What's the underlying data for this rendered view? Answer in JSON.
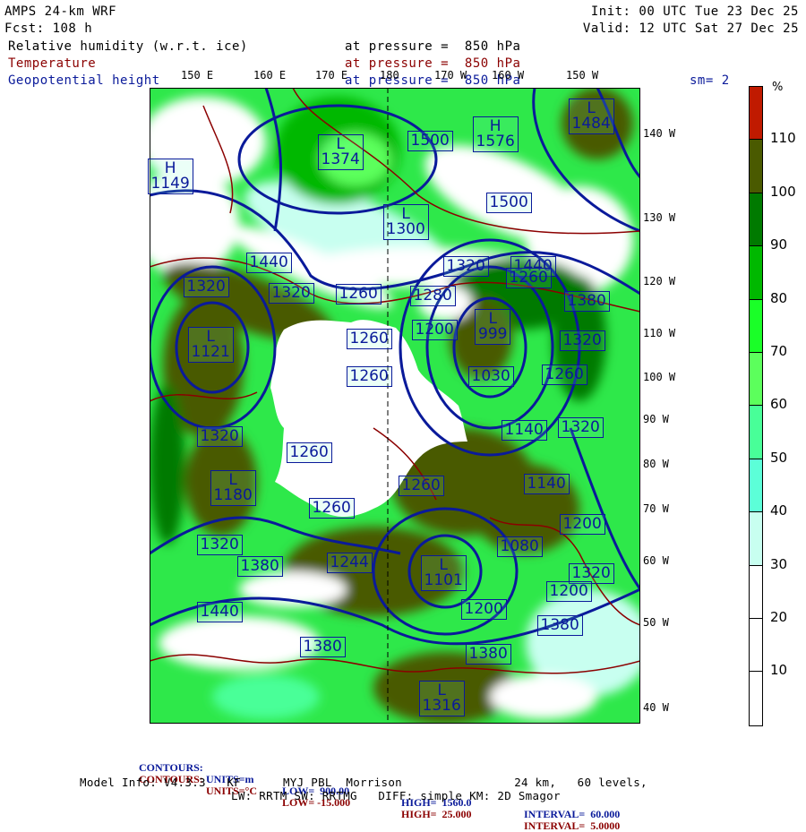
{
  "header": {
    "model": "AMPS 24-km WRF",
    "forecast": "Fcst: 108 h",
    "init": "Init: 00 UTC Tue 23 Dec 25",
    "valid": "Valid: 12 UTC Sat 27 Dec 25",
    "fields": [
      {
        "name": "Relative humidity (w.r.t. ice)",
        "level": "at pressure =  850 hPa",
        "color": "#000000"
      },
      {
        "name": "Temperature",
        "level": "at pressure =  850 hPa",
        "color": "#8b0000"
      },
      {
        "name": "Geopotential height",
        "level": "at pressure =  850 hPa",
        "color": "#0a1a9a"
      }
    ],
    "smoothing": "sm= 2"
  },
  "map": {
    "top_longitudes": [
      "150 E",
      "160 E",
      "170 E",
      "180",
      "170 W",
      "160 W",
      "150 W"
    ],
    "right_longitudes": [
      "140 W",
      "130 W",
      "120 W",
      "110 W",
      "100 W",
      "90 W",
      "80 W",
      "70 W",
      "60 W",
      "50 W",
      "40 W"
    ],
    "height_labels": [
      "L\n1374",
      "1500",
      "H\n1576",
      "L\n1484",
      "H\n1149",
      "1500",
      "L\n1300",
      "1440",
      "1440",
      "1320",
      "1260",
      "1320",
      "1320",
      "1280",
      "1260",
      "1380",
      "L\n999",
      "L\n1121",
      "1200",
      "1320",
      "1260",
      "1030",
      "1260",
      "1260",
      "1140",
      "1320",
      "1320",
      "1260",
      "1260",
      "1140",
      "L\n1180",
      "1260",
      "1200",
      "1320",
      "1244",
      "1380",
      "L\n1101",
      "1080",
      "1320",
      "1200",
      "1440",
      "1200",
      "1380",
      "1380",
      "1380",
      "L\n1316"
    ],
    "colors": {
      "height": "#0a1a9a",
      "temperature": "#8b0000"
    }
  },
  "colorbar": {
    "unit": "%",
    "ticks": [
      "110",
      "100",
      "90",
      "80",
      "70",
      "60",
      "50",
      "40",
      "30",
      "20",
      "10"
    ],
    "colors": [
      "#c01a00",
      "#4a5a00",
      "#007a00",
      "#00b800",
      "#1aff28",
      "#5cff5c",
      "#48ff98",
      "#5cffd8",
      "#c8fff0",
      "#ffffff",
      "#ffffff",
      "#ffffff"
    ]
  },
  "footer": {
    "contours_height": {
      "label": "CONTOURS:",
      "units": "UNITS=m",
      "low": "LOW=  900.00",
      "high": "HIGH=  1560.0",
      "interval": "INTERVAL=  60.000"
    },
    "contours_temp": {
      "label": "CONTOURS:",
      "units": "UNITS=°C",
      "low": "LOW= -15.000",
      "high": "HIGH=  25.000",
      "interval": "INTERVAL=  5.0000"
    },
    "model_info_1": "Model Info: V4.3.3   KF      MYJ PBL  Morrison                24 km,   60 levels,",
    "model_info_2": "LW: RRTM SW: RRTMG   DIFF: simple KM: 2D Smagor"
  }
}
